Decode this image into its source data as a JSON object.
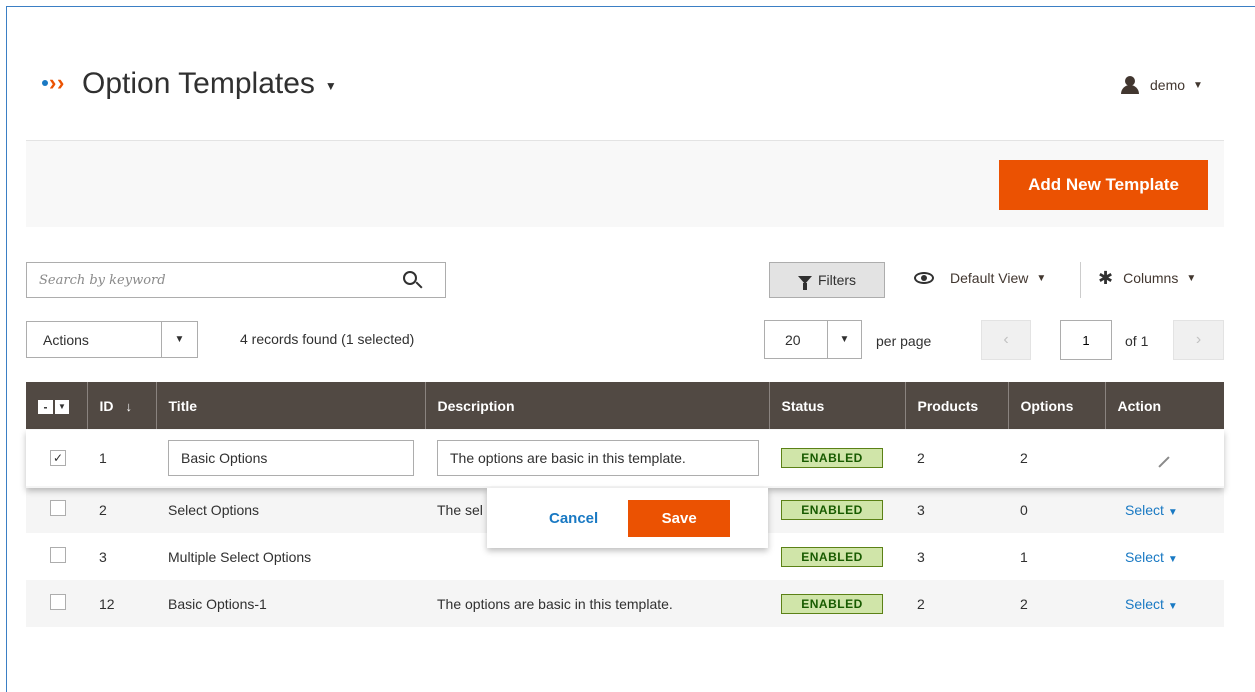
{
  "header": {
    "title": "Option Templates",
    "user_name": "demo"
  },
  "action_bar": {
    "add_button": "Add New Template"
  },
  "toolbar": {
    "search_placeholder": "Search by keyword",
    "filters_label": "Filters",
    "view_label": "Default View",
    "columns_label": "Columns",
    "actions_label": "Actions",
    "records_text": "4 records found (1 selected)",
    "per_page_value": "20",
    "per_page_label": "per page",
    "page_value": "1",
    "page_of": "of 1"
  },
  "grid": {
    "columns": [
      "ID",
      "Title",
      "Description",
      "Status",
      "Products",
      "Options",
      "Action"
    ],
    "rows": [
      {
        "id": "1",
        "title": "Basic Options",
        "description": "The options are basic in this template.",
        "status": "ENABLED",
        "products": "2",
        "options": "2",
        "checked": true,
        "editing": true
      },
      {
        "id": "2",
        "title": "Select Options",
        "description": "The sel",
        "status": "ENABLED",
        "products": "3",
        "options": "0",
        "checked": false,
        "action": "Select"
      },
      {
        "id": "3",
        "title": "Multiple Select Options",
        "description": "",
        "status": "ENABLED",
        "products": "3",
        "options": "1",
        "checked": false,
        "action": "Select"
      },
      {
        "id": "12",
        "title": "Basic Options-1",
        "description": "The options are basic in this template.",
        "status": "ENABLED",
        "products": "2",
        "options": "2",
        "checked": false,
        "action": "Select"
      }
    ]
  },
  "inline_edit": {
    "cancel_label": "Cancel",
    "save_label": "Save"
  },
  "colors": {
    "accent": "#eb5202",
    "header_bg": "#514943",
    "link": "#1979c3",
    "status_bg": "#d0e5a9"
  }
}
